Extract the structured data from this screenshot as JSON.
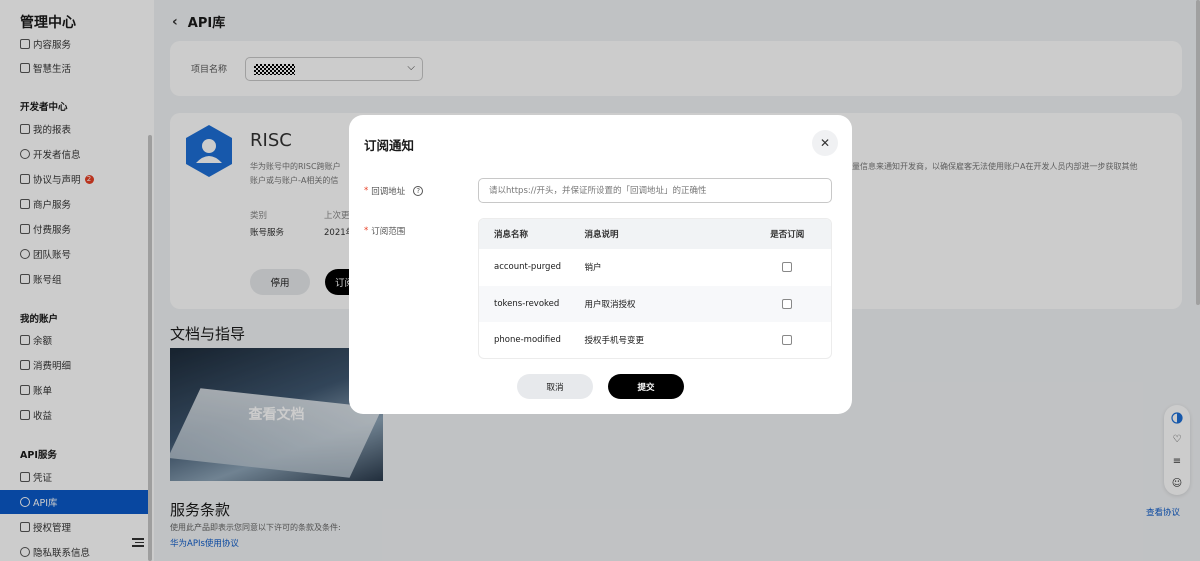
{
  "sidebar": {
    "logo": "管理中心",
    "top_items": [
      {
        "label": "内容服务",
        "icon": "layers-icon"
      },
      {
        "label": "智慧生活",
        "icon": "home-icon"
      }
    ],
    "groups": [
      {
        "title": "开发者中心",
        "items": [
          {
            "label": "我的报表",
            "icon": "chart-icon"
          },
          {
            "label": "开发者信息",
            "icon": "user-icon"
          },
          {
            "label": "协议与声明",
            "icon": "agreement-icon",
            "badge": "2"
          },
          {
            "label": "商户服务",
            "icon": "shop-icon"
          },
          {
            "label": "付费服务",
            "icon": "card-icon"
          },
          {
            "label": "团队账号",
            "icon": "team-icon"
          },
          {
            "label": "账号组",
            "icon": "group-icon"
          }
        ]
      },
      {
        "title": "我的账户",
        "items": [
          {
            "label": "余额",
            "icon": "wallet-icon"
          },
          {
            "label": "消费明细",
            "icon": "list-icon"
          },
          {
            "label": "账单",
            "icon": "bill-icon"
          },
          {
            "label": "收益",
            "icon": "income-icon"
          }
        ]
      },
      {
        "title": "API服务",
        "items": [
          {
            "label": "凭证",
            "icon": "credential-icon"
          },
          {
            "label": "API库",
            "icon": "api-icon",
            "active": true
          },
          {
            "label": "授权管理",
            "icon": "auth-icon"
          },
          {
            "label": "隐私联系信息",
            "icon": "privacy-icon"
          }
        ]
      }
    ]
  },
  "header": {
    "title": "API库"
  },
  "project": {
    "label": "项目名称",
    "value_masked": true
  },
  "api_card": {
    "name": "RISC",
    "desc_left": "华为账号中的RISC跨账户",
    "desc_left_2": "账户或与账户-A相关的信",
    "desc_right": "量信息来通知开发商，以确保雇客无法使用账户A在开发人员内部进一步获取其他",
    "category_label": "类别",
    "category_value": "账号服务",
    "updated_label": "上次更",
    "updated_value": "2021年",
    "stop_button": "停用",
    "subscribe_button": "订阅"
  },
  "docs": {
    "title": "文档与指导",
    "image_label": "查看文档"
  },
  "terms": {
    "title": "服务条款",
    "text": "使用此产品即表示您同意以下许可的条款及条件:",
    "link": "华为APIs使用协议",
    "view_link": "查看协议"
  },
  "modal": {
    "title": "订阅通知",
    "callback_label": "回调地址",
    "callback_placeholder": "请以https://开头，并保证所设置的「回调地址」的正确性",
    "scope_label": "订阅范围",
    "table": {
      "headers": [
        "消息名称",
        "消息说明",
        "是否订阅"
      ],
      "rows": [
        {
          "name": "account-purged",
          "desc": "销户",
          "subscribed": false
        },
        {
          "name": "tokens-revoked",
          "desc": "用户取消授权",
          "subscribed": false
        },
        {
          "name": "phone-modified",
          "desc": "授权手机号变更",
          "subscribed": false
        }
      ]
    },
    "cancel": "取消",
    "submit": "提交"
  },
  "colors": {
    "accent": "#0a59c8",
    "hex_icon": "#1d6fd6",
    "danger": "#e84026"
  }
}
